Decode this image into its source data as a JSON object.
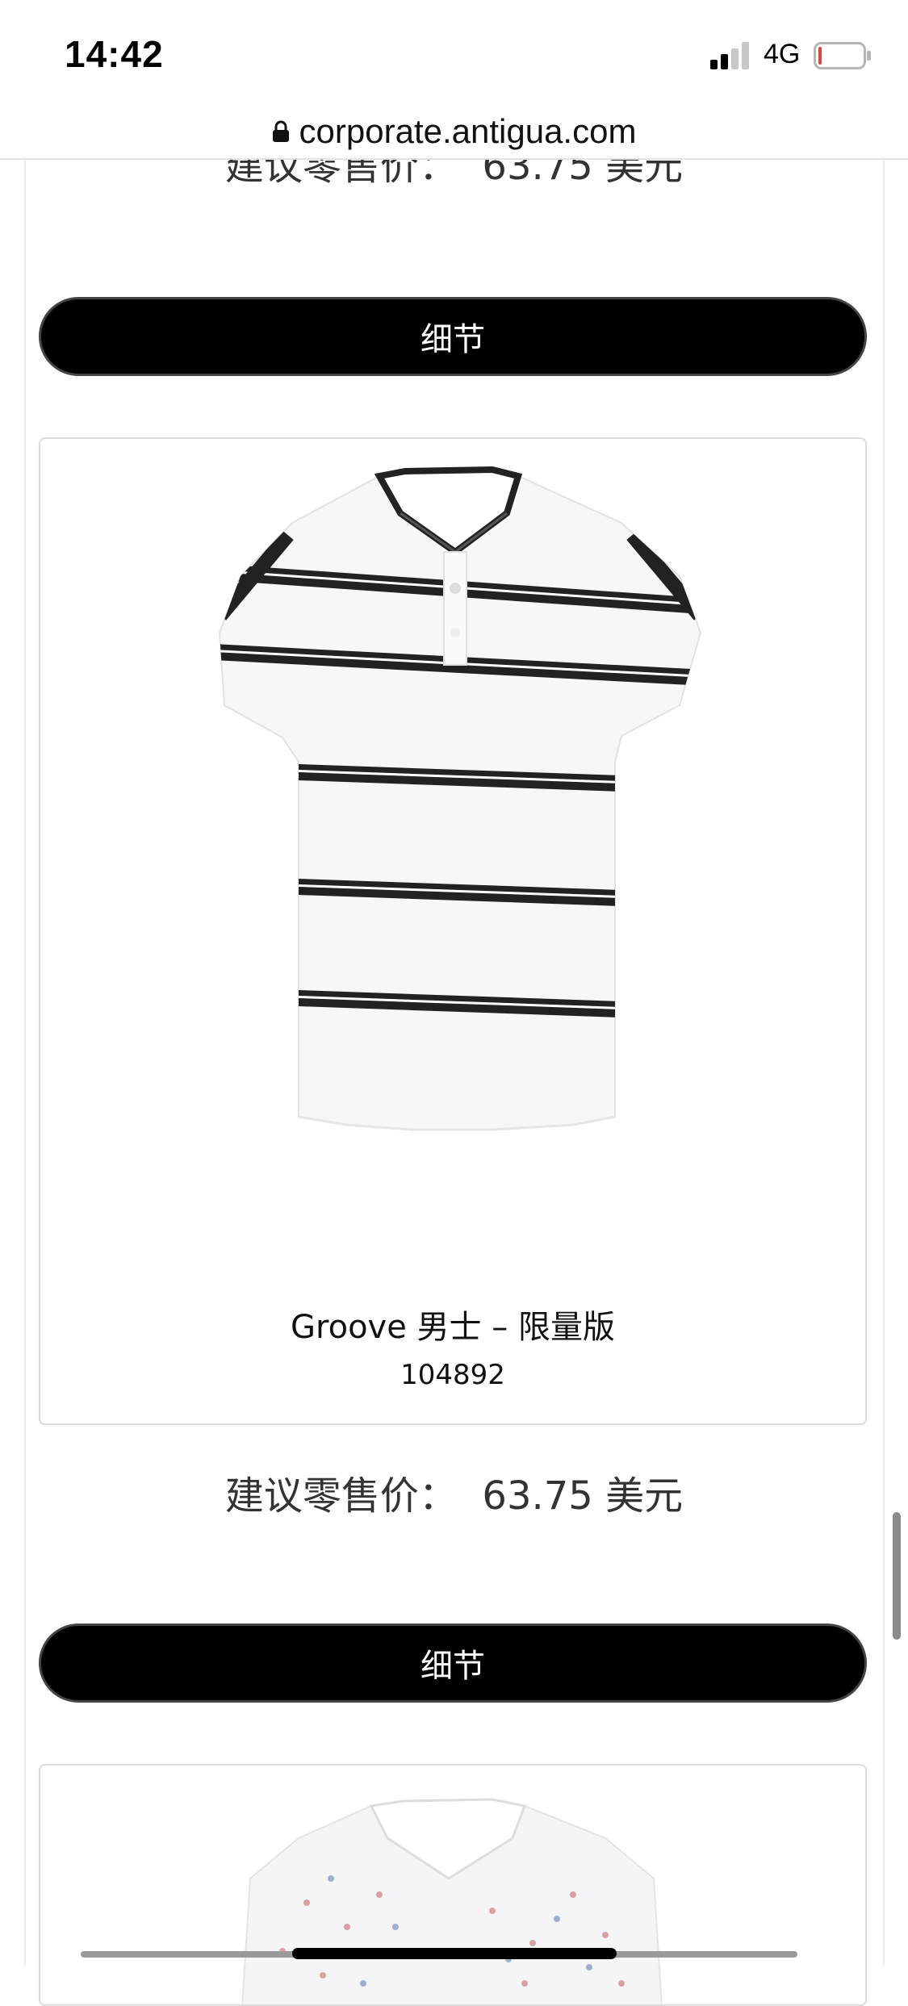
{
  "status_bar": {
    "time": "14:42",
    "network": "4G",
    "signal_bars_active": 2,
    "signal_bars_total": 4,
    "battery_level": 0.05,
    "battery_color": "#e0463c"
  },
  "browser": {
    "url": "corporate.antigua.com",
    "lock_icon": "lock-icon"
  },
  "products": [
    {
      "price_label": "建议零售价：",
      "price_value": "63.75 美元",
      "details_label": "细节"
    },
    {
      "name": "Groove 男士 – 限量版",
      "sku": "104892",
      "image": "white-striped-polo-shirt",
      "price_label": "建议零售价：",
      "price_value": "63.75 美元",
      "details_label": "细节"
    },
    {
      "image": "white-patterned-polo-shirt"
    }
  ],
  "colors": {
    "button_bg": "#000000",
    "button_text": "#ffffff",
    "price_text": "#333333",
    "card_border": "#dcdcdc"
  }
}
